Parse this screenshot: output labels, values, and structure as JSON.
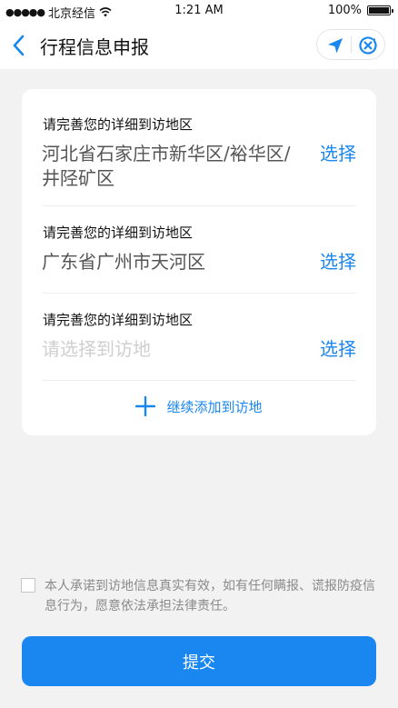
{
  "status_bar": {
    "signal": "●●●●●",
    "carrier": "北京经信",
    "time": "1:21 AM",
    "battery_percent": "100%",
    "battery_level": 1.0
  },
  "nav": {
    "title": "行程信息申报"
  },
  "regions": [
    {
      "label": "请完善您的详细到访地区",
      "value": "河北省石家庄市新华区/裕华区/井陉矿区",
      "action": "选择"
    },
    {
      "label": "请完善您的详细到访地区",
      "value": "广东省广州市天河区",
      "action": "选择"
    },
    {
      "label": "请完善您的详细到访地区",
      "placeholder": "请选择到访地",
      "action": "选择"
    }
  ],
  "add_more": {
    "label": "继续添加到访地"
  },
  "agreement": {
    "text": "本人承诺到访地信息真实有效，如有任何瞒报、谎报防疫信息行为，愿意依法承担法律责任。",
    "checked": false
  },
  "submit": {
    "label": "提交"
  },
  "colors": {
    "accent": "#1a86f0",
    "page_background": "#f2f2f2",
    "placeholder": "#cfcfcf"
  }
}
